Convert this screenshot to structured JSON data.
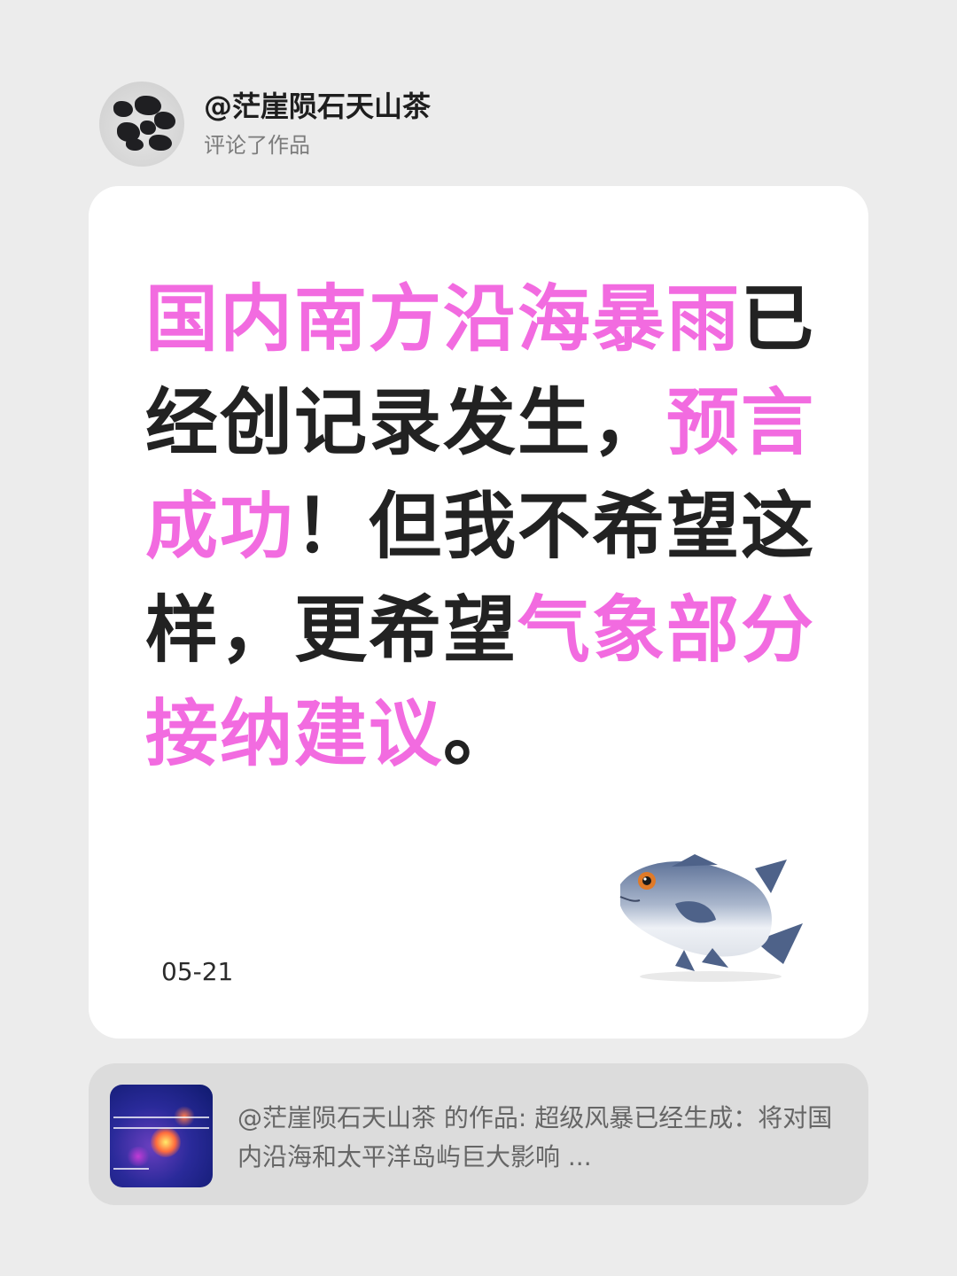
{
  "header": {
    "username": "@茫崖陨石天山茶",
    "action": "评论了作品"
  },
  "comment": {
    "segments": [
      {
        "text": "国内南方沿海暴雨",
        "highlight": true
      },
      {
        "text": "已经创记录发生，",
        "highlight": false
      },
      {
        "text": "预言成功",
        "highlight": true
      },
      {
        "text": "！但我不希望这样，更希望",
        "highlight": false
      },
      {
        "text": "气象部分接纳建议",
        "highlight": true
      },
      {
        "text": "。",
        "highlight": false
      }
    ],
    "date": "05-21",
    "emoji": "fish-icon"
  },
  "reference": {
    "text": "@茫崖陨石天山茶  的作品: 超级风暴已经生成：将对国内沿海和太平洋岛屿巨大影响 ..."
  },
  "colors": {
    "background": "#ececec",
    "card": "#ffffff",
    "highlight": "#f26be0",
    "text": "#222222",
    "reference_bg": "#dcdcdc"
  }
}
